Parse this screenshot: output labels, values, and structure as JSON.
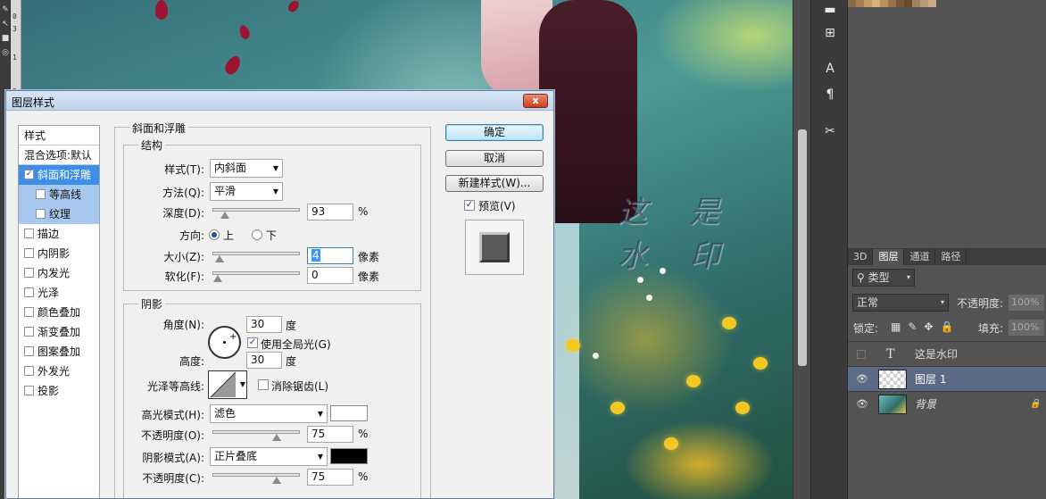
{
  "ruler": {
    "marks": [
      "0",
      "1",
      "2",
      "3"
    ]
  },
  "canvas": {
    "watermark": "这 是 水 印"
  },
  "swatch_colors": [
    "#8b6a4a",
    "#a67b55",
    "#c79a6a",
    "#d9b07a",
    "#b8905e",
    "#9a7248",
    "#7a5636",
    "#6a4a2e",
    "#9c8464",
    "#b39a78",
    "#caa983"
  ],
  "layers_panel": {
    "tabs": [
      "3D",
      "图层",
      "通道",
      "路径"
    ],
    "active_tab": "图层",
    "filter_kind": "类型",
    "blend_mode": "正常",
    "opacity_label": "不透明度:",
    "opacity_value": "100%",
    "lock_label": "锁定:",
    "fill_label": "填充:",
    "fill_value": "100%",
    "layers": [
      {
        "name": "这是水印",
        "kind": "text",
        "visible": false,
        "selected": false
      },
      {
        "name": "图层 1",
        "kind": "pixel",
        "visible": true,
        "selected": true
      },
      {
        "name": "背景",
        "kind": "background",
        "visible": true,
        "selected": false,
        "locked": true
      }
    ]
  },
  "dialog": {
    "title": "图层样式",
    "close": "x",
    "styles_header": "样式",
    "blend_options": "混合选项:默认",
    "styles": [
      {
        "label": "斜面和浮雕",
        "checked": true,
        "active": true
      },
      {
        "label": "等高线",
        "checked": false,
        "sub": true
      },
      {
        "label": "纹理",
        "checked": false,
        "sub": true
      },
      {
        "label": "描边",
        "checked": false
      },
      {
        "label": "内阴影",
        "checked": false
      },
      {
        "label": "内发光",
        "checked": false
      },
      {
        "label": "光泽",
        "checked": false
      },
      {
        "label": "颜色叠加",
        "checked": false
      },
      {
        "label": "渐变叠加",
        "checked": false
      },
      {
        "label": "图案叠加",
        "checked": false
      },
      {
        "label": "外发光",
        "checked": false
      },
      {
        "label": "投影",
        "checked": false
      }
    ],
    "bevel": {
      "section_title": "斜面和浮雕",
      "structure_title": "结构",
      "style_label": "样式(T):",
      "style_value": "内斜面",
      "technique_label": "方法(Q):",
      "technique_value": "平滑",
      "depth_label": "深度(D):",
      "depth_value": "93",
      "depth_unit": "%",
      "depth_slider": 0.09,
      "direction_label": "方向:",
      "direction_up": "上",
      "direction_down": "下",
      "size_label": "大小(Z):",
      "size_value": "4",
      "size_unit": "像素",
      "size_slider": 0.02,
      "soften_label": "软化(F):",
      "soften_value": "0",
      "soften_unit": "像素",
      "soften_slider": 0.0
    },
    "shading": {
      "title": "阴影",
      "angle_label": "角度(N):",
      "angle_value": "30",
      "angle_unit": "度",
      "global_light_label": "使用全局光(G)",
      "global_light": true,
      "altitude_label": "高度:",
      "altitude_value": "30",
      "altitude_unit": "度",
      "gloss_label": "光泽等高线:",
      "antialias_label": "消除锯齿(L)",
      "antialias": false,
      "highlight_mode_label": "高光模式(H):",
      "highlight_mode": "滤色",
      "highlight_color": "#ffffff",
      "highlight_opacity_label": "不透明度(O):",
      "highlight_opacity": "75",
      "highlight_opacity_slider": 0.75,
      "shadow_mode_label": "阴影模式(A):",
      "shadow_mode": "正片叠底",
      "shadow_color": "#000000",
      "shadow_opacity_label": "不透明度(C):",
      "shadow_opacity": "75",
      "shadow_opacity_slider": 0.75,
      "percent": "%"
    },
    "buttons": {
      "ok": "确定",
      "cancel": "取消",
      "new_style": "新建样式(W)...",
      "preview_label": "预览(V)",
      "preview": true
    }
  }
}
